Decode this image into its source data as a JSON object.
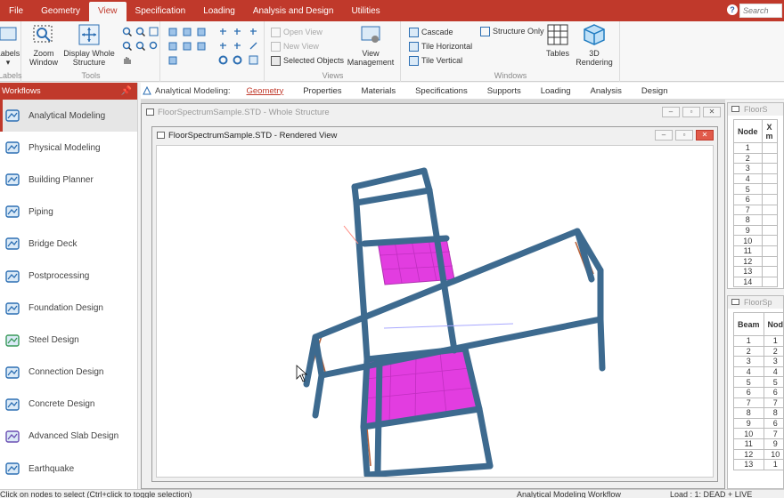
{
  "menu": {
    "items": [
      "File",
      "Geometry",
      "View",
      "Specification",
      "Loading",
      "Analysis and Design",
      "Utilities"
    ],
    "active": "View",
    "search_placeholder": "Search",
    "accent_color": "#c0392b"
  },
  "ribbon": {
    "labels_group": {
      "button": "Labels",
      "group_label": "Labels"
    },
    "zoom_window": "Zoom Window",
    "display_whole": "Display Whole Structure",
    "tools_label": "Tools",
    "views": {
      "open_view": "Open View",
      "new_view": "New View",
      "selected_objects": "Selected Objects",
      "view_management": "View Management",
      "group_label": "Views"
    },
    "windows": {
      "cascade": "Cascade",
      "tile_horizontal": "Tile Horizontal",
      "tile_vertical": "Tile Vertical",
      "structure_only": "Structure Only",
      "tables": "Tables",
      "rendering": "3D Rendering",
      "group_label": "Windows"
    }
  },
  "workflows": {
    "title": "Workflows",
    "items": [
      {
        "label": "Analytical Modeling",
        "icon": "analytical-icon"
      },
      {
        "label": "Physical Modeling",
        "icon": "physical-icon"
      },
      {
        "label": "Building Planner",
        "icon": "building-icon"
      },
      {
        "label": "Piping",
        "icon": "piping-icon"
      },
      {
        "label": "Bridge Deck",
        "icon": "bridge-icon"
      },
      {
        "label": "Postprocessing",
        "icon": "postprocessing-icon"
      },
      {
        "label": "Foundation Design",
        "icon": "foundation-icon"
      },
      {
        "label": "Steel Design",
        "icon": "steel-icon"
      },
      {
        "label": "Connection Design",
        "icon": "connection-icon"
      },
      {
        "label": "Concrete Design",
        "icon": "concrete-icon"
      },
      {
        "label": "Advanced Slab Design",
        "icon": "slab-icon"
      },
      {
        "label": "Earthquake",
        "icon": "earthquake-icon"
      }
    ],
    "active": "Analytical Modeling"
  },
  "subtoolbar": {
    "label": "Analytical Modeling:",
    "tabs": [
      "Geometry",
      "Properties",
      "Materials",
      "Specifications",
      "Supports",
      "Loading",
      "Analysis",
      "Design"
    ],
    "active": "Geometry"
  },
  "windows": {
    "outer_title": "FloorSpectrumSample.STD - Whole Structure",
    "inner_title": "FloorSpectrumSample.STD - Rendered View"
  },
  "node_table": {
    "title": "FloorS",
    "header": "Node",
    "header2": "X",
    "header2b": "m",
    "rows": [
      "1",
      "2",
      "3",
      "4",
      "5",
      "6",
      "7",
      "8",
      "9",
      "10",
      "11",
      "12",
      "13",
      "14"
    ]
  },
  "beam_table": {
    "title": "FloorSp",
    "header": "Beam",
    "header2": "Nod",
    "rows": [
      [
        "1",
        "1"
      ],
      [
        "2",
        "2"
      ],
      [
        "3",
        "3"
      ],
      [
        "4",
        "4"
      ],
      [
        "5",
        "5"
      ],
      [
        "6",
        "6"
      ],
      [
        "7",
        "7"
      ],
      [
        "8",
        "8"
      ],
      [
        "9",
        "6"
      ],
      [
        "10",
        "7"
      ],
      [
        "11",
        "9"
      ],
      [
        "12",
        "10"
      ],
      [
        "13",
        "1"
      ]
    ]
  },
  "status": {
    "left": "Click on nodes to select (Ctrl+click to toggle selection)",
    "mid": "Analytical Modeling Workflow",
    "right": "Load : 1: DEAD + LIVE"
  },
  "colors": {
    "frame": "#3d6a8f",
    "slab": "#e23de0",
    "support": "#b8623a"
  }
}
